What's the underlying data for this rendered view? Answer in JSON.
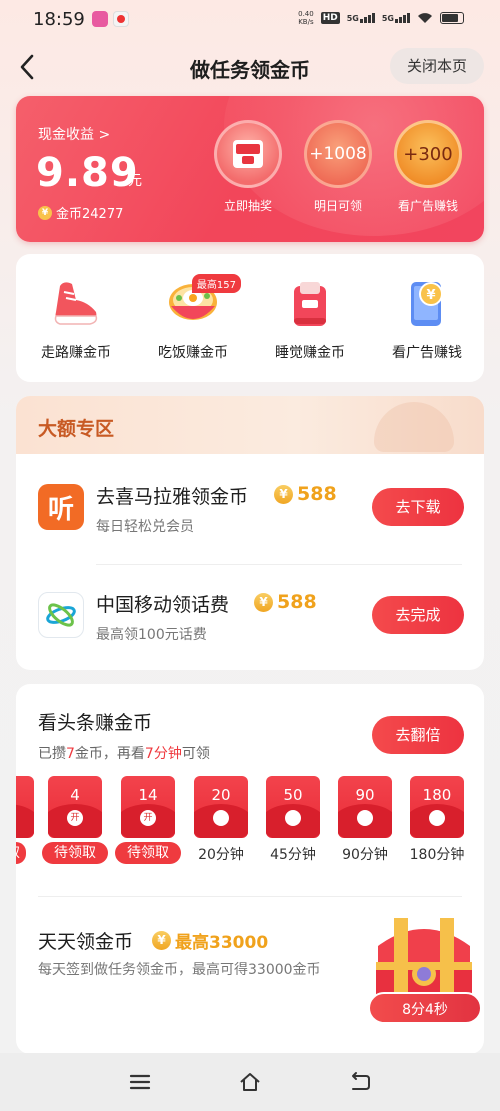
{
  "status_bar": {
    "time": "18:59",
    "net_speed": "0.40\nKB/s",
    "hd": "HD",
    "net1": "5G",
    "net2": "5G"
  },
  "header": {
    "title": "做任务领金币",
    "close_label": "关闭本页"
  },
  "earnings": {
    "cash_label": "现金收益 >",
    "cash_amount": "9.89",
    "cash_unit": "元",
    "coins": "金币24277",
    "items": [
      {
        "value": "",
        "label": "立即抽奖"
      },
      {
        "value": "+1008",
        "label": "明日可领"
      },
      {
        "value": "+300",
        "label": "看广告赚钱"
      }
    ]
  },
  "quick_tasks": [
    {
      "label": "走路赚金币",
      "icon": "sneaker-icon"
    },
    {
      "label": "吃饭赚金币",
      "icon": "meal-bowl-icon",
      "badge": "最高157"
    },
    {
      "label": "睡觉赚金币",
      "icon": "sleep-icon"
    },
    {
      "label": "看广告赚钱",
      "icon": "phone-coin-icon"
    }
  ],
  "big_zone": {
    "title": "大额专区",
    "tasks": [
      {
        "title": "去喜马拉雅领金币",
        "reward": "588",
        "subtitle": "每日轻松兑会员",
        "button": "去下载",
        "logo_text": "听"
      },
      {
        "title": "中国移动领话费",
        "reward": "588",
        "subtitle": "最高领100元话费",
        "button": "去完成"
      }
    ]
  },
  "news": {
    "title": "看头条赚金币",
    "sub_prefix": "已攒",
    "sub_coins": "7",
    "sub_mid": "金币，再看",
    "sub_minutes": "7分钟",
    "sub_suffix": "可领",
    "button": "去翻倍",
    "envelopes": [
      {
        "value": "",
        "caption": "取",
        "seal": "",
        "pending": true
      },
      {
        "value": "4",
        "caption": "待领取",
        "seal": "开",
        "pending": true
      },
      {
        "value": "14",
        "caption": "待领取",
        "seal": "开",
        "pending": true
      },
      {
        "value": "20",
        "caption": "20分钟",
        "seal": "",
        "pending": false
      },
      {
        "value": "50",
        "caption": "45分钟",
        "seal": "",
        "pending": false
      },
      {
        "value": "90",
        "caption": "90分钟",
        "seal": "",
        "pending": false
      },
      {
        "value": "180",
        "caption": "180分钟",
        "seal": "",
        "pending": false
      }
    ]
  },
  "daily": {
    "title": "天天领金币",
    "reward": "最高33000",
    "subtitle": "每天签到做任务领金币，最高可得33000金币",
    "timer": "8分4秒"
  },
  "colors": {
    "accent": "#ef3a3f",
    "gold": "#f0a21c",
    "zone_title": "#c85a24"
  }
}
